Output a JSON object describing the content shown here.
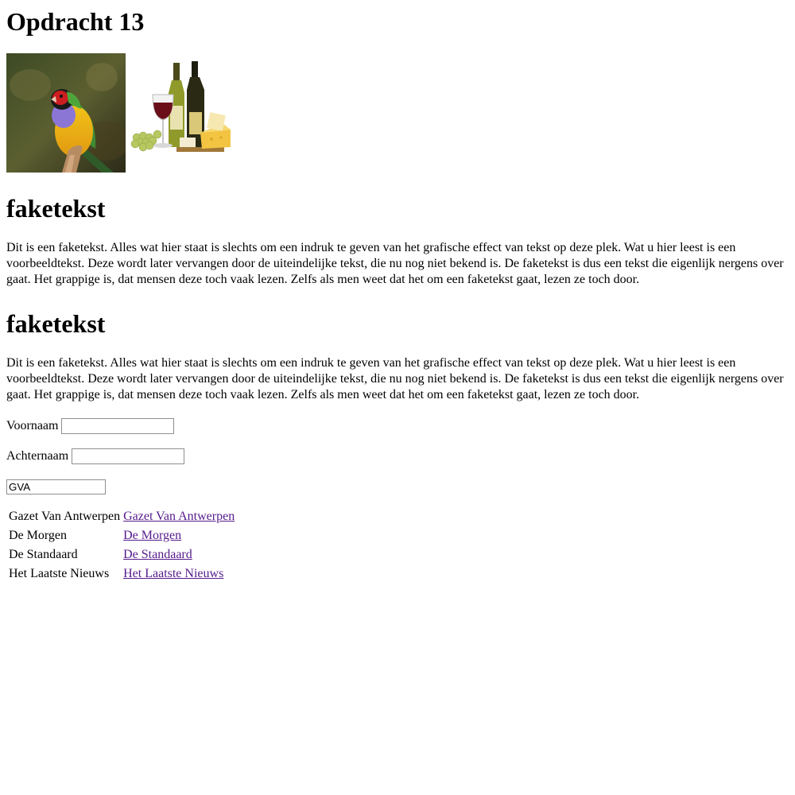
{
  "page": {
    "title": "Opdracht 13"
  },
  "images": [
    {
      "name": "bird-image",
      "alt": "Kleurrijke vogel"
    },
    {
      "name": "wine-cheese-image",
      "alt": "Wijn en kaas"
    }
  ],
  "sections": [
    {
      "heading": "faketekst",
      "text": "Dit is een faketekst. Alles wat hier staat is slechts om een indruk te geven van het grafische effect van tekst op deze plek. Wat u hier leest is een voorbeeldtekst. Deze wordt later vervangen door de uiteindelijke tekst, die nu nog niet bekend is. De faketekst is dus een tekst die eigenlijk nergens over gaat. Het grappige is, dat mensen deze toch vaak lezen. Zelfs als men weet dat het om een faketekst gaat, lezen ze toch door."
    },
    {
      "heading": "faketekst",
      "text": "Dit is een faketekst. Alles wat hier staat is slechts om een indruk te geven van het grafische effect van tekst op deze plek. Wat u hier leest is een voorbeeldtekst. Deze wordt later vervangen door de uiteindelijke tekst, die nu nog niet bekend is. De faketekst is dus een tekst die eigenlijk nergens over gaat. Het grappige is, dat mensen deze toch vaak lezen. Zelfs als men weet dat het om een faketekst gaat, lezen ze toch door."
    }
  ],
  "form": {
    "voornaam_label": "Voornaam",
    "voornaam_value": "",
    "achternaam_label": "Achternaam",
    "achternaam_value": "",
    "select_value": "GVA"
  },
  "newspapers": [
    {
      "name": "Gazet Van Antwerpen",
      "link": "Gazet Van Antwerpen"
    },
    {
      "name": "De Morgen",
      "link": "De Morgen"
    },
    {
      "name": "De Standaard",
      "link": "De Standaard"
    },
    {
      "name": "Het Laatste Nieuws",
      "link": "Het Laatste Nieuws"
    }
  ],
  "colors": {
    "link_visited": "#551a8b",
    "input_border": "#8f8f8f"
  }
}
